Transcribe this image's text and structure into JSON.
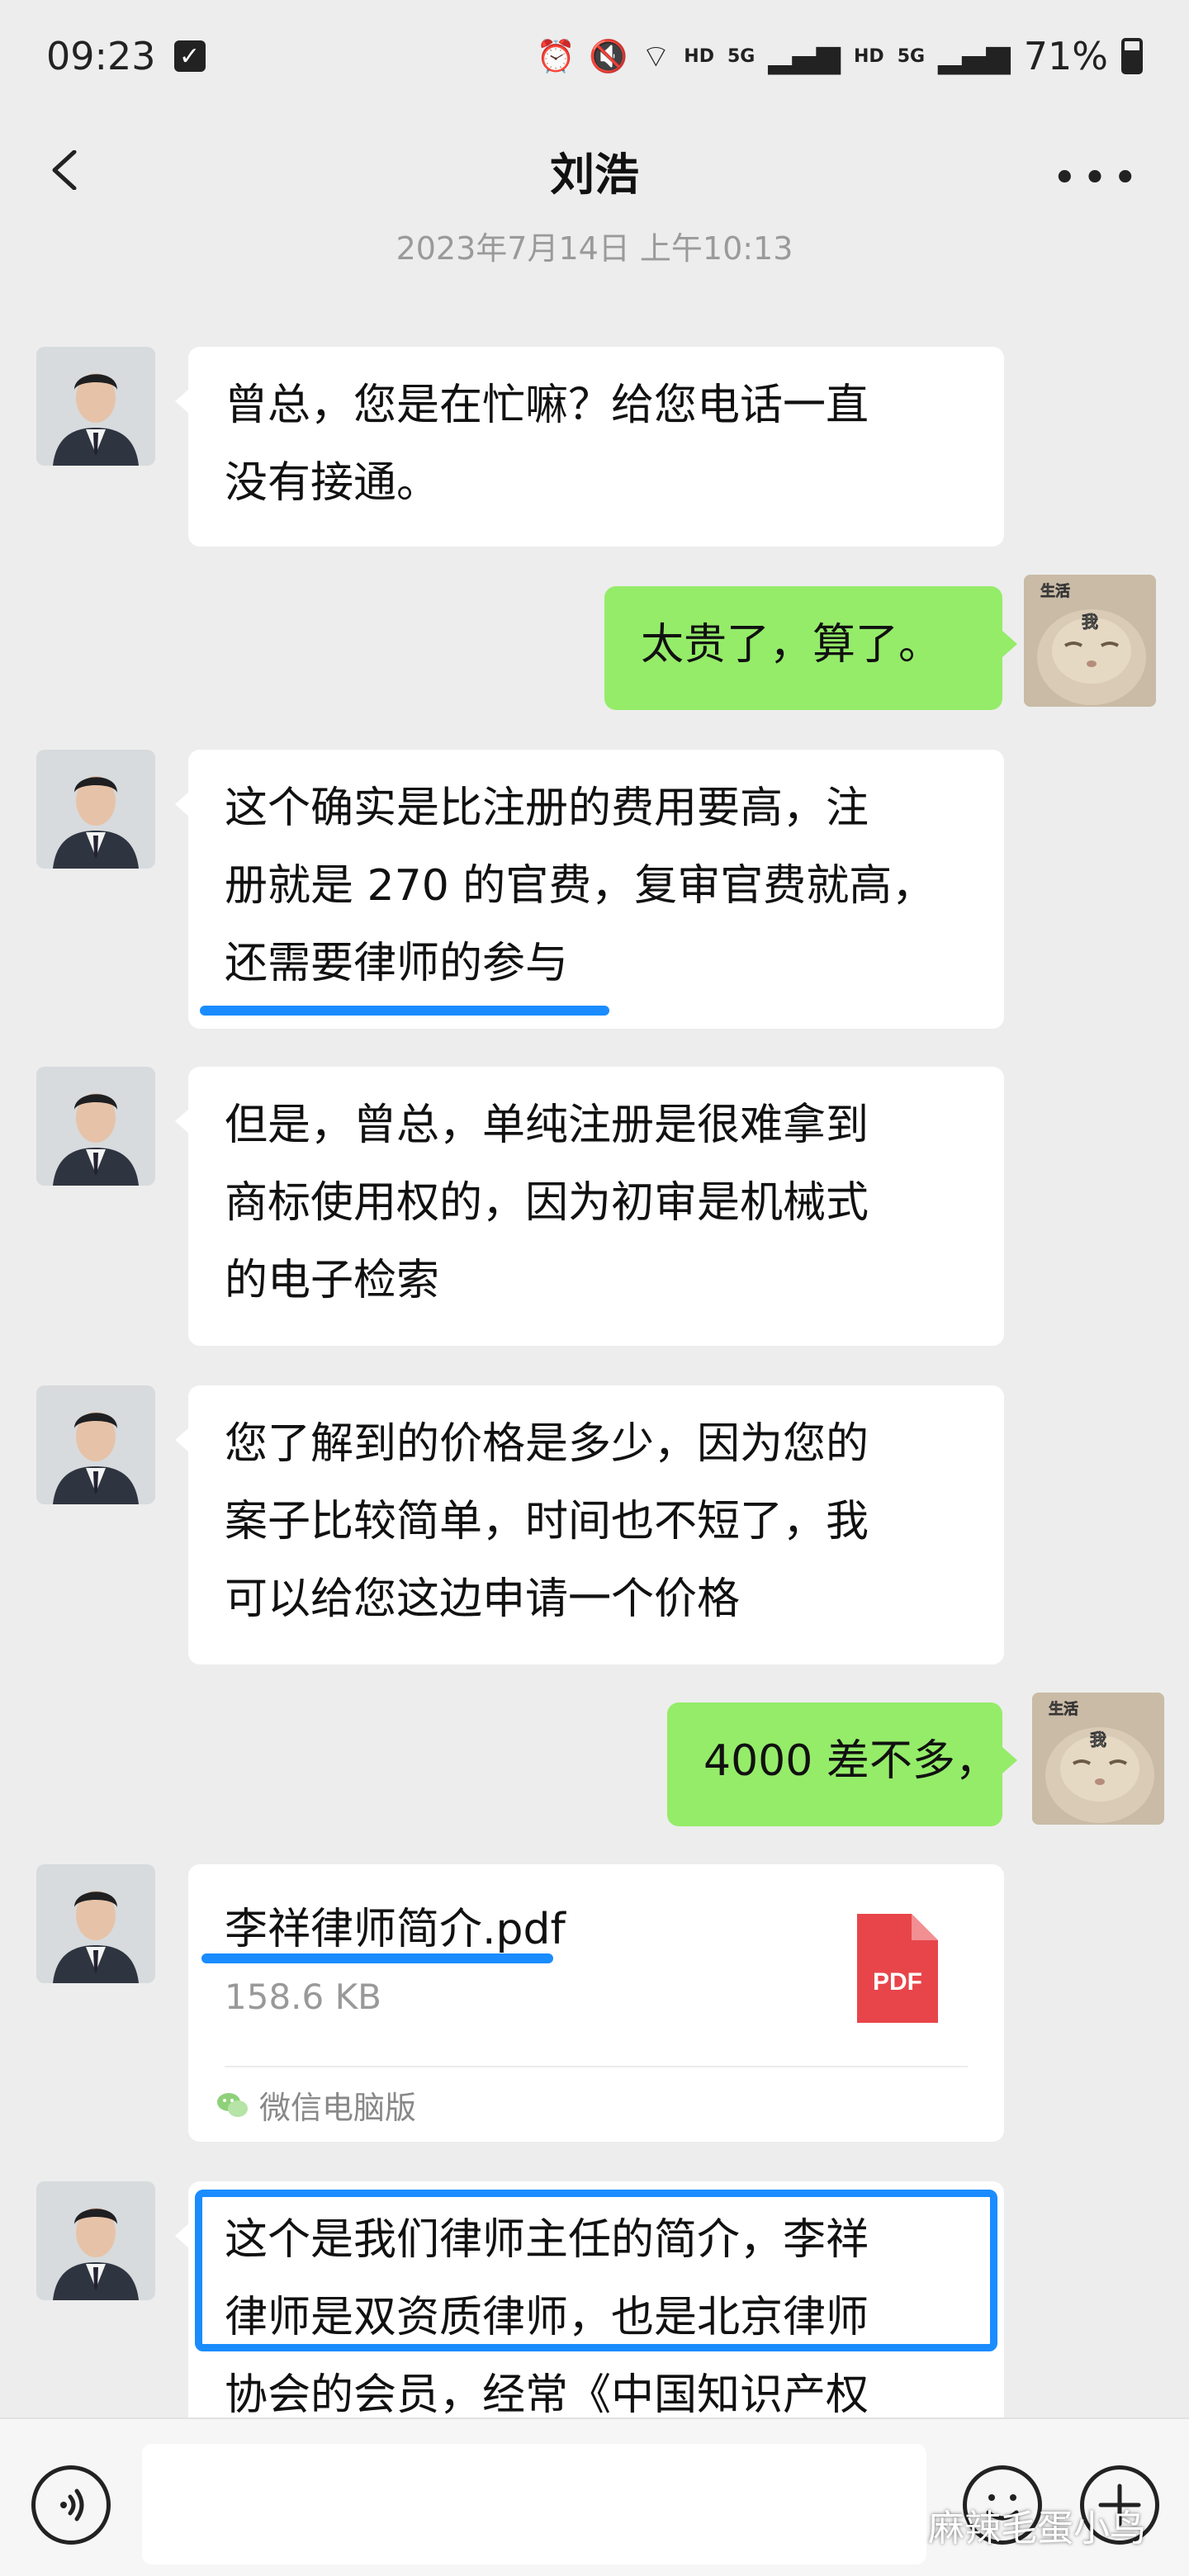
{
  "status_bar": {
    "time": "09:23",
    "network_1": "HD",
    "network_2": "HD",
    "signal_1": "5G",
    "signal_2": "5G",
    "battery": "71%"
  },
  "chat": {
    "title": "刘浩",
    "timestamp": "2023年7月14日 上午10:13"
  },
  "messages": [
    {
      "side": "left",
      "lines": [
        "曾总，您是在忙嘛？给您电话一直",
        "没有接通。"
      ]
    },
    {
      "side": "right",
      "lines": [
        "太贵了，算了。"
      ],
      "sticker_text": [
        "生活",
        "我"
      ]
    },
    {
      "side": "left",
      "lines": [
        "这个确实是比注册的费用要高，注",
        "册就是 270 的官费，复审官费就高，",
        "还需要律师的参与"
      ]
    },
    {
      "side": "left",
      "lines": [
        "但是，曾总，单纯注册是很难拿到",
        "商标使用权的，因为初审是机械式",
        "的电子检索"
      ]
    },
    {
      "side": "left",
      "lines": [
        "您了解到的价格是多少，因为您的",
        "案子比较简单，时间也不短了，我",
        "可以给您这边申请一个价格"
      ]
    },
    {
      "side": "right",
      "lines": [
        "4000 差不多，"
      ],
      "sticker_text": [
        "生活",
        "我"
      ]
    },
    {
      "side": "left",
      "type": "file",
      "file_name": "李祥律师简介.pdf",
      "file_size": "158.6  KB",
      "file_type": "PDF",
      "source": "微信电脑版"
    },
    {
      "side": "left",
      "lines": [
        "这个是我们律师主任的简介，李祥",
        "律师是双资质律师，也是北京律师",
        "协会的会员，经常《中国知识产权"
      ]
    }
  ],
  "watermark": "麻辣毛蛋小鸟",
  "colors": {
    "background": "#ededed",
    "my_bubble": "#95ec69",
    "their_bubble": "#ffffff",
    "annotation_blue": "#1a8cff",
    "pdf_red": "#e8454a"
  },
  "icons": [
    "back-arrow-icon",
    "more-icon",
    "voice-icon",
    "emoji-icon",
    "plus-icon",
    "pdf-icon",
    "wechat-icon",
    "alarm-icon",
    "mute-icon",
    "wifi-icon",
    "battery-icon"
  ]
}
